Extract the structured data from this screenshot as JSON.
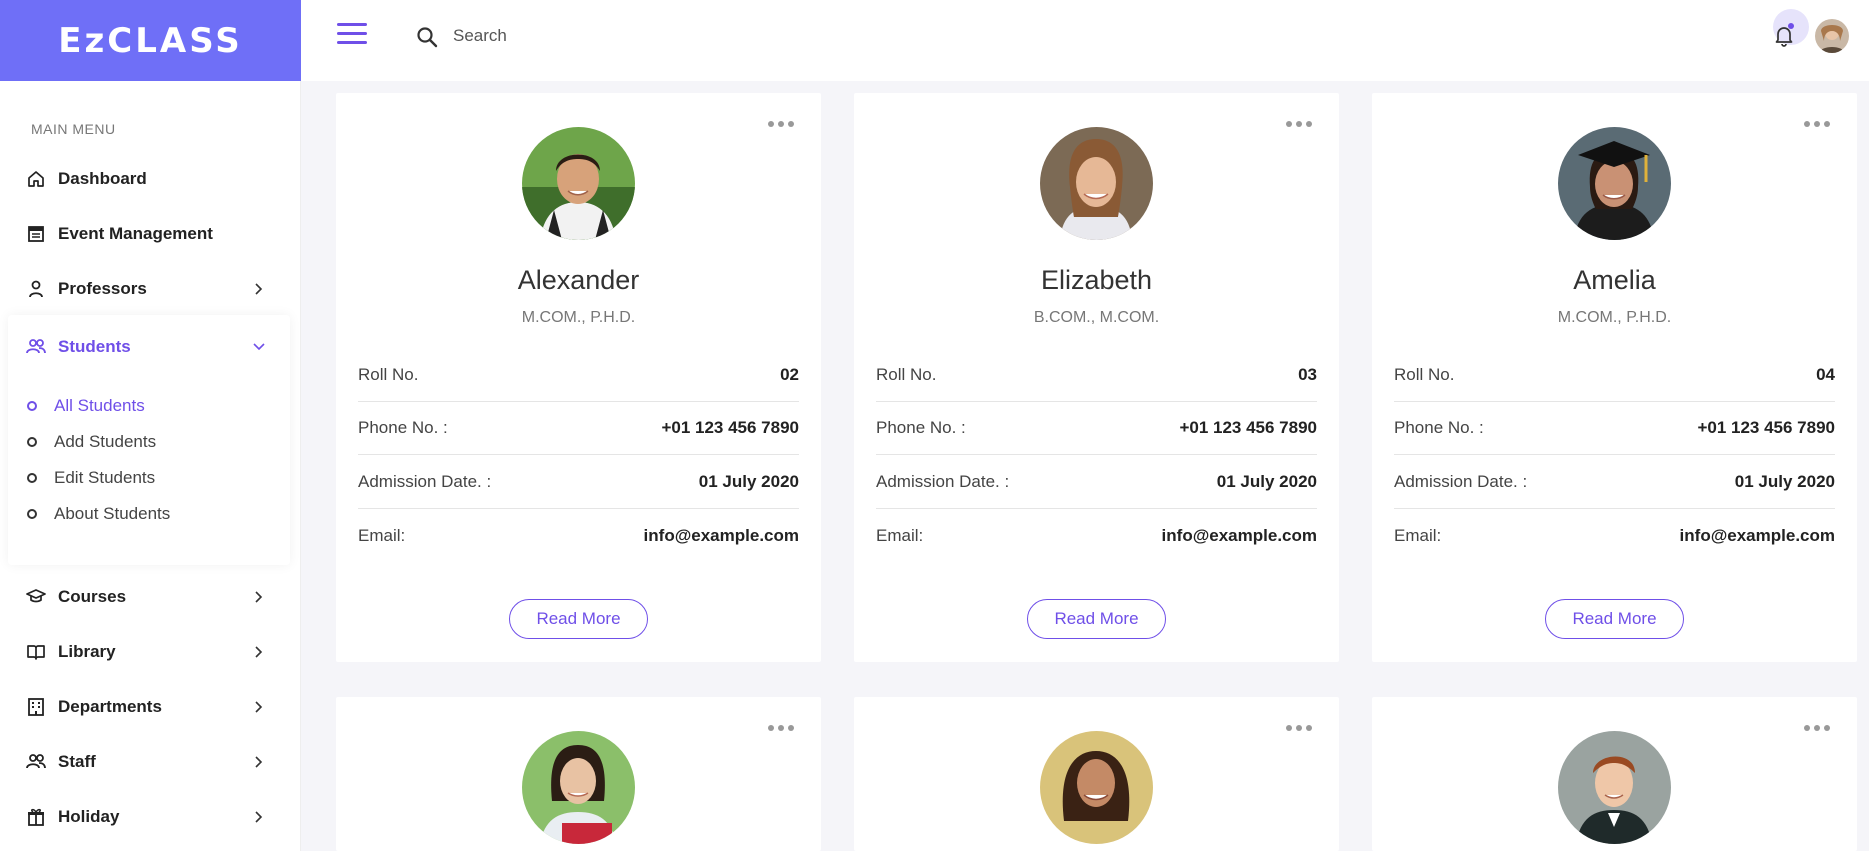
{
  "brand": {
    "logo_text": "EzCLASS",
    "accent": "#6f6ff7",
    "primary": "#6f4fe8"
  },
  "topbar": {
    "search_placeholder": "Search",
    "menu_icon": "hamburger-icon",
    "search_icon": "search-icon",
    "notifications_icon": "bell-icon"
  },
  "sidebar": {
    "menu_title": "MAIN MENU",
    "items": [
      {
        "label": "Dashboard",
        "icon": "home-icon"
      },
      {
        "label": "Event Management",
        "icon": "calendar-icon"
      },
      {
        "label": "Professors",
        "icon": "user-icon"
      },
      {
        "label": "Students",
        "icon": "users-icon"
      },
      {
        "label": "Courses",
        "icon": "graduation-cap-icon"
      },
      {
        "label": "Library",
        "icon": "book-icon"
      },
      {
        "label": "Departments",
        "icon": "building-icon"
      },
      {
        "label": "Staff",
        "icon": "users-icon"
      },
      {
        "label": "Holiday",
        "icon": "gift-icon"
      }
    ],
    "students_sub": [
      {
        "label": "All Students",
        "active": true
      },
      {
        "label": "Add Students"
      },
      {
        "label": "Edit Students"
      },
      {
        "label": "About Students"
      }
    ]
  },
  "labels": {
    "roll": "Roll No.",
    "phone": "Phone No. :",
    "admission": "Admission Date. :",
    "email": "Email:",
    "read_more": "Read More"
  },
  "students": [
    {
      "name": "Alexander",
      "degree": "M.COM., P.H.D.",
      "roll": "02",
      "phone": "+01 123 456 7890",
      "admission": "01 July 2020",
      "email": "info@example.com"
    },
    {
      "name": "Elizabeth",
      "degree": "B.COM., M.COM.",
      "roll": "03",
      "phone": "+01 123 456 7890",
      "admission": "01 July 2020",
      "email": "info@example.com"
    },
    {
      "name": "Amelia",
      "degree": "M.COM., P.H.D.",
      "roll": "04",
      "phone": "+01 123 456 7890",
      "admission": "01 July 2020",
      "email": "info@example.com"
    }
  ]
}
